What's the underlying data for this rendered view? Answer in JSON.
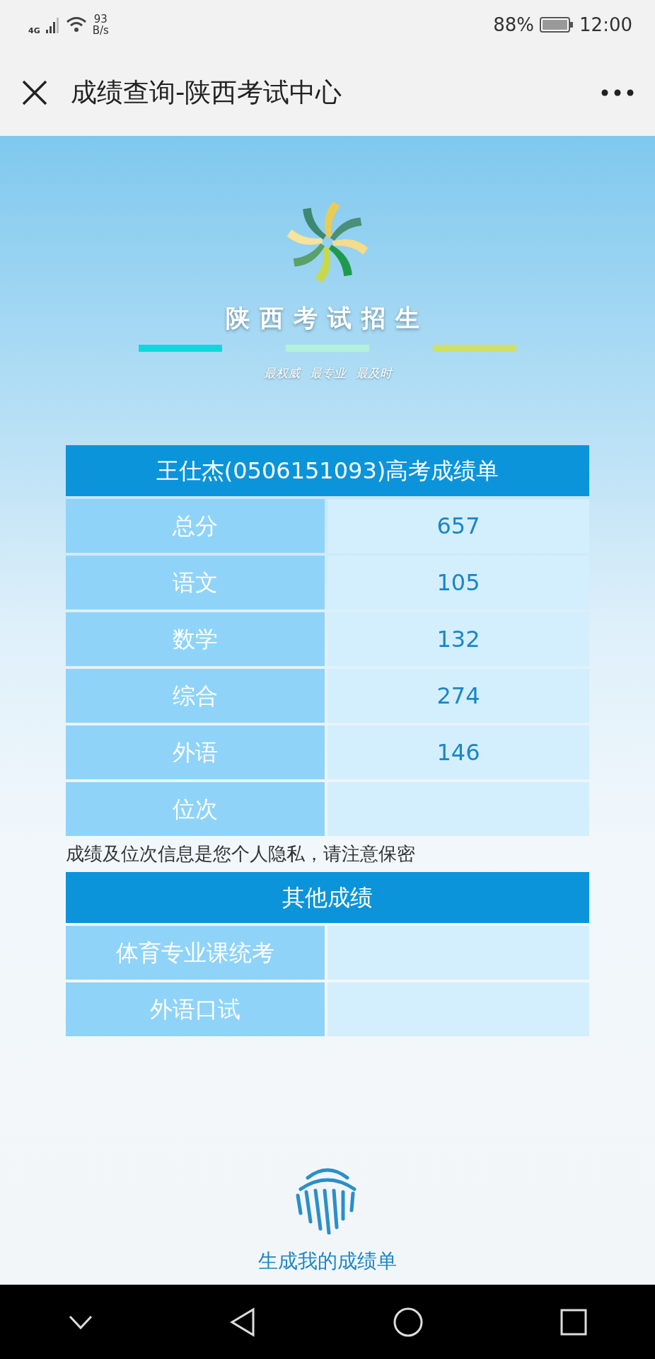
{
  "status_bar": {
    "network": "4G",
    "speed_value": "93",
    "speed_unit": "B/s",
    "battery": "88%",
    "time": "12:00"
  },
  "title_bar": {
    "title": "成绩查询-陕西考试中心"
  },
  "banner": {
    "name": "陕西考试招生",
    "slogans": [
      "最权威",
      "最专业",
      "最及时"
    ]
  },
  "score_table": {
    "title": "王仕杰(0506151093)高考成绩单",
    "rows": [
      {
        "label": "总分",
        "value": "657"
      },
      {
        "label": "语文",
        "value": "105"
      },
      {
        "label": "数学",
        "value": "132"
      },
      {
        "label": "综合",
        "value": "274"
      },
      {
        "label": "外语",
        "value": "146"
      },
      {
        "label": "位次"
      }
    ]
  },
  "privacy_note": "成绩及位次信息是您个人隐私，请注意保密",
  "other_table": {
    "title": "其他成绩",
    "rows": [
      {
        "label": "体育专业课统考"
      },
      {
        "label": "外语口试"
      }
    ]
  },
  "generate_button": {
    "label": "生成我的成绩单"
  }
}
